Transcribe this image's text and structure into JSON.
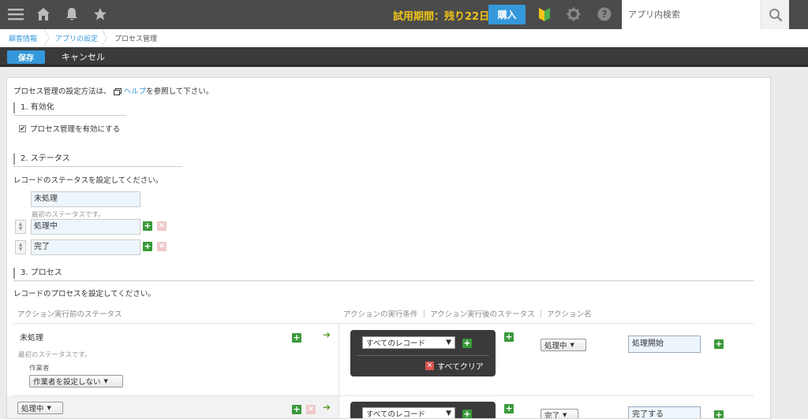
{
  "header": {
    "trial_text": "試用期間：残り22日",
    "buy_label": "購入",
    "search_placeholder": "アプリ内検索"
  },
  "breadcrumb": {
    "items": [
      "顧客情報",
      "アプリの設定",
      "プロセス管理"
    ]
  },
  "toolbar": {
    "save_label": "保存",
    "cancel_label": "キャンセル"
  },
  "intro": {
    "prefix": "プロセス管理の設定方法は、",
    "help_link": "ヘルプ",
    "suffix": "を参照して下さい。"
  },
  "section1": {
    "title": "1. 有効化",
    "checkbox_label": "プロセス管理を有効にする",
    "checked": true
  },
  "section2": {
    "title": "2. ステータス",
    "description": "レコードのステータスを設定してください。",
    "statuses": [
      "未処理",
      "処理中",
      "完了"
    ],
    "first_status_note": "最初のステータスです。"
  },
  "section3": {
    "title": "3. プロセス",
    "description": "レコードのプロセスを設定してください。",
    "col_before": "アクション実行前のステータス",
    "col_after": "アクションの実行条件 ｜ アクション実行後のステータス ｜ アクション名",
    "rows": [
      {
        "status": "未処理",
        "note": "最初のステータスです。",
        "assignee_label": "作業者",
        "assignee_value": "作業者を設定しない",
        "condition": "すべてのレコード",
        "clear_all": "すべてクリア",
        "next_status": "処理中",
        "action_name": "処理開始"
      },
      {
        "status": "処理中",
        "condition": "すべてのレコード",
        "next_status": "完了",
        "action_name": "完了する"
      }
    ]
  },
  "colors": {
    "header_bg": "#4b4b4b",
    "accent": "#3498db",
    "trial": "#f0c419",
    "add_green": "#3a9a3a"
  }
}
